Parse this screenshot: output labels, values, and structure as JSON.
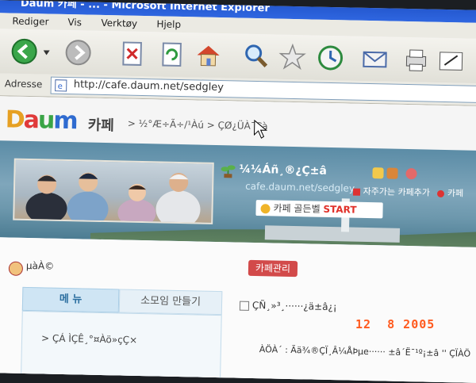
{
  "window": {
    "title": "Daum 카페 - ... - Microsoft Internet Explorer"
  },
  "menu": [
    "Rediger",
    "Vis",
    "Verktøy",
    "Hjelp"
  ],
  "toolbar": {
    "icons": [
      "back-icon",
      "forward-icon",
      "stop-icon",
      "refresh-icon",
      "home-icon",
      "search-icon",
      "favorites-icon",
      "history-icon",
      "mail-icon",
      "print-icon",
      "edit-icon"
    ]
  },
  "address": {
    "label": "Adresse",
    "url": "http://cafe.daum.net/sedgley"
  },
  "header": {
    "logo_letters": [
      "D",
      "a",
      "u",
      "m"
    ],
    "cafe_label": "카페",
    "breadcrumb": "> ½°Æ÷Ã÷/¹Àú > ÇØ¿ÜÀ¯Çà"
  },
  "banner": {
    "cafe_title": "¼¼Áñ¸®¿Ç±â",
    "cafe_url": "cafe.daum.net/sedgley",
    "favorite_text": "자주가는 카페추가",
    "cafe_btn": "카페",
    "golden_text": "카페 골든벨",
    "golden_start": "START"
  },
  "lower": {
    "user_label": "µàÀ©",
    "admin_button": "카페관리",
    "tab_menu": "메 뉴",
    "tab_small_group": "소모임 만들기",
    "menu_item": "> ÇÁ ÌÇÊ¸°¤Àö»çÇ×",
    "notice_title": "ÇÑ¸»³¸······¿ä±â¿¡",
    "content_line": "ÀÖÀ´ : Ãä¾®ÇÏ¸Â¼ÅÞµe······ ±â´Ë¯¹º¡±â '' ÇÏÀÖ"
  },
  "camera": {
    "timestamp": "12  8 2005"
  },
  "colors": {
    "accent_red": "#d24a4a",
    "timestamp": "#ff5a1e",
    "title_blue": "#2f66e0"
  }
}
